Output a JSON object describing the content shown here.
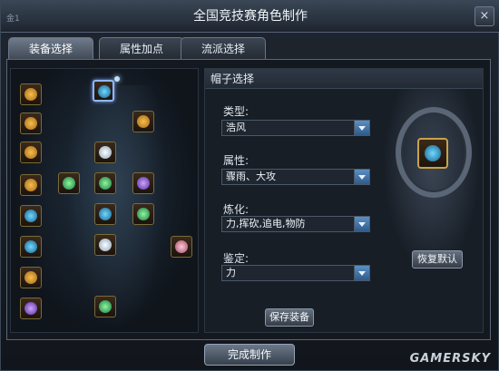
{
  "window": {
    "title": "全国竞技赛角色制作",
    "corner_text": "金1"
  },
  "tabs": [
    {
      "label": "装备选择",
      "active": true
    },
    {
      "label": "属性加点",
      "active": false
    },
    {
      "label": "流派选择",
      "active": false
    }
  ],
  "equipment": {
    "slots": [
      {
        "name": "slot-left-1",
        "icon": "gold-helm-icon",
        "color": "gold"
      },
      {
        "name": "slot-left-2",
        "icon": "gold-armor-icon",
        "color": "gold"
      },
      {
        "name": "slot-left-3",
        "icon": "gold-bracer-icon",
        "color": "gold"
      },
      {
        "name": "slot-left-4",
        "icon": "gold-boots-icon",
        "color": "gold"
      },
      {
        "name": "slot-left-5",
        "icon": "blue-ring-icon",
        "color": "blue"
      },
      {
        "name": "slot-left-6",
        "icon": "blue-ring-icon",
        "color": "blue"
      },
      {
        "name": "slot-left-7",
        "icon": "gold-necklace-icon",
        "color": "gold"
      },
      {
        "name": "slot-left-8",
        "icon": "purple-amulet-icon",
        "color": "purple"
      },
      {
        "name": "slot-head",
        "icon": "hat-icon",
        "color": "blue",
        "selected": true
      },
      {
        "name": "slot-shoulder",
        "icon": "shoulder-icon",
        "color": "gold"
      },
      {
        "name": "slot-chest",
        "icon": "chest-icon",
        "color": "white"
      },
      {
        "name": "slot-weapon",
        "icon": "weapon-icon",
        "color": "green"
      },
      {
        "name": "slot-body",
        "icon": "robe-icon",
        "color": "green"
      },
      {
        "name": "slot-offhand",
        "icon": "offhand-icon",
        "color": "purple"
      },
      {
        "name": "slot-belt",
        "icon": "belt-icon",
        "color": "blue"
      },
      {
        "name": "slot-orb",
        "icon": "orb-icon",
        "color": "green"
      },
      {
        "name": "slot-legs",
        "icon": "legs-icon",
        "color": "white"
      },
      {
        "name": "slot-pet",
        "icon": "pet-icon",
        "color": "pink"
      },
      {
        "name": "slot-feet",
        "icon": "feet-icon",
        "color": "green"
      }
    ]
  },
  "editor": {
    "section_title": "帽子选择",
    "type_label": "类型:",
    "type_value": "浩风",
    "attr_label": "属性:",
    "attr_value": "骤雨、大攻",
    "refine_label": "炼化:",
    "refine_value": "力,挥砍,追电,物防",
    "appraise_label": "鉴定:",
    "appraise_value": "力",
    "save_button": "保存装备",
    "reset_button": "恢复默认"
  },
  "footer": {
    "finish_button": "完成制作",
    "watermark": "GAMERSKY"
  }
}
